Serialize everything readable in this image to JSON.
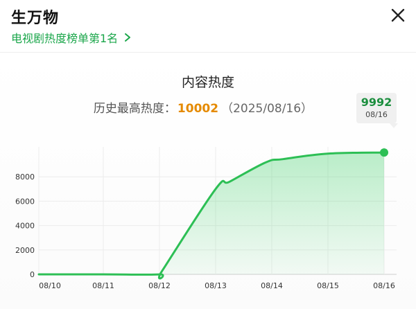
{
  "header": {
    "title": "生万物",
    "rank_link": "电视剧热度榜单第1名",
    "close_icon": "close-icon"
  },
  "card": {
    "title": "内容热度",
    "record_label": "历史最高热度：",
    "record_value": "10002",
    "record_date": "（2025/08/16）"
  },
  "tooltip": {
    "value": "9992",
    "date": "08/16"
  },
  "colors": {
    "accent": "#1aa64a",
    "line": "#2dbf55",
    "record_value": "#e58a00"
  },
  "chart_data": {
    "type": "area",
    "x": [
      "08/10",
      "08/11",
      "08/12",
      "08/13",
      "08/14",
      "08/15",
      "08/16"
    ],
    "points": [
      {
        "x": "08/10",
        "y": 0
      },
      {
        "x": "08/11",
        "y": 0
      },
      {
        "x": "08/12",
        "y": 0
      },
      {
        "x": "08/12",
        "y": 300
      },
      {
        "x": "08/13",
        "y": 7000
      },
      {
        "x": "08/13",
        "y": 7600
      },
      {
        "x": "08/14",
        "y": 9200
      },
      {
        "x": "08/14",
        "y": 9450
      },
      {
        "x": "08/15",
        "y": 9900
      },
      {
        "x": "08/16",
        "y": 9992
      }
    ],
    "x_index": [
      0,
      1,
      2,
      2.05,
      3.0,
      3.25,
      3.9,
      4.2,
      5.0,
      6.0
    ],
    "yticks": [
      0,
      2000,
      4000,
      6000,
      8000
    ],
    "ylim": [
      0,
      10000
    ],
    "grid": true
  }
}
